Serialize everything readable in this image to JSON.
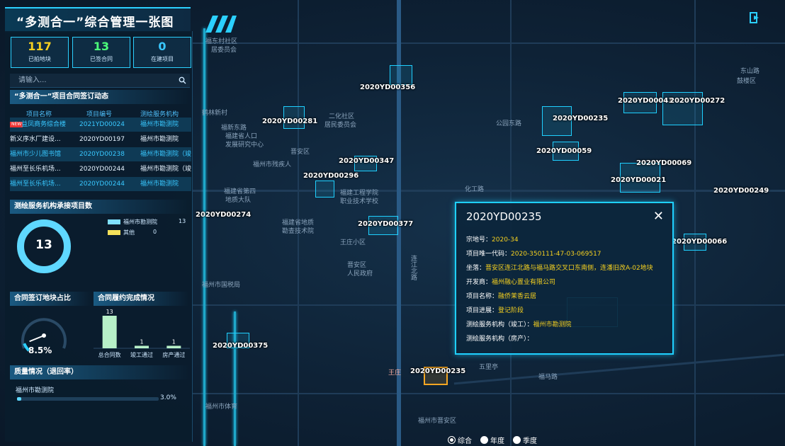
{
  "app": {
    "title": "“多测合一”综合管理一张图",
    "top_right_icon": "exit-icon",
    "accent": "#1fd0ff",
    "highlight": "#f5d020"
  },
  "stats": [
    {
      "value": "117",
      "label": "已拍地块",
      "color": "#f5d020"
    },
    {
      "value": "13",
      "label": "已签合同",
      "color": "#4cff7a"
    },
    {
      "value": "0",
      "label": "在建项目",
      "color": "#39c8ff"
    }
  ],
  "search": {
    "placeholder": "请输入..."
  },
  "contracts": {
    "title": "“多测合一”项目合同签订动态",
    "columns": [
      "项目名称",
      "项目编号",
      "测绘服务机构"
    ],
    "rows": [
      {
        "badge": "NEW",
        "name": "益凤商务综合楼",
        "code": "2021YD00024",
        "org": "福州市勘测院"
      },
      {
        "badge": "",
        "name": "新义序水厂建设...",
        "code": "2020YD00197",
        "org": "福州市勘测院"
      },
      {
        "badge": "",
        "name": "福州市少儿图书馆",
        "code": "2020YD00238",
        "org": "福州市勘测院（竣..."
      },
      {
        "badge": "",
        "name": "福州至长乐机场...",
        "code": "2020YD00244",
        "org": "福州市勘测院（竣..."
      },
      {
        "badge": "",
        "name": "福州至长乐机场...",
        "code": "2020YD00244",
        "org": "福州市勘测院"
      }
    ]
  },
  "service_orgs": {
    "title": "测绘服务机构承接项目数",
    "total": "13",
    "legend": [
      {
        "name": "福州市勘测院",
        "value": "13",
        "color": "#7fe0ff"
      },
      {
        "name": "其他",
        "value": "0",
        "color": "#f5e15a"
      }
    ]
  },
  "contract_ratio": {
    "title": "合同签订地块占比",
    "value": "8.5%",
    "fraction": 0.085
  },
  "fulfillment": {
    "title": "合同履约完成情况",
    "chart_data": {
      "type": "bar",
      "categories": [
        "总合同数",
        "竣工通过",
        "房产通过"
      ],
      "values": [
        13,
        1,
        1
      ],
      "ylim": [
        0,
        13
      ]
    }
  },
  "quality": {
    "title": "质量情况（退回率）",
    "items": [
      {
        "name": "福州市勘测院",
        "value": "3.0%",
        "fraction": 0.03
      }
    ]
  },
  "popup": {
    "title": "2020YD00235",
    "rows": [
      {
        "label": "宗地号：",
        "value": "2020-34"
      },
      {
        "label": "项目唯一代码：",
        "value": "2020-350111-47-03-069517"
      },
      {
        "label": "坐落：",
        "value": "晋安区连江北路与福马路交叉口东南侧，连潘旧改A-02地块"
      },
      {
        "label": "开发商：",
        "value": "福州融心置业有限公司"
      },
      {
        "label": "项目名称：",
        "value": "融侨茉香云居"
      },
      {
        "label": "项目进展：",
        "value": "登记阶段"
      },
      {
        "label": "测绘服务机构（竣工）：",
        "value": "福州市勘测院"
      },
      {
        "label": "测绘服务机构（房产）：",
        "value": ""
      }
    ]
  },
  "map": {
    "plot_labels": [
      "2020YD00356",
      "2020YD00281",
      "2020YD00235",
      "2020YD00043",
      "2020YD00272",
      "2020YD00059",
      "2020YD00069",
      "2020YD00296",
      "2020YD00347",
      "2020YD00021",
      "2020YD00249",
      "2020YD00377",
      "2020YD00066",
      "2020YD00375",
      "2020YD00235",
      "2020YD00274"
    ],
    "place_labels": [
      "福东村社区",
      "居委员会",
      "鹤林新村",
      "福建省人口",
      "发展研究中心",
      "二化社区",
      "居民委员会",
      "福新东路",
      "福州市残疾人",
      "福建省第四",
      "地质大队",
      "福建工程学院",
      "职业技术学校",
      "福建省地质",
      "勘查技术院",
      "晋安区",
      "人民政府",
      "福州市国税局",
      "福马路",
      "五里亭",
      "王庄",
      "公园东路",
      "化工路",
      "连江北路",
      "福州市晋安区",
      "王庄小区",
      "鼓楼区",
      "东山路",
      "福州市体育",
      "晋安区"
    ]
  },
  "timeframe": {
    "options": [
      "综合",
      "年度",
      "季度"
    ],
    "selected": "综合"
  }
}
